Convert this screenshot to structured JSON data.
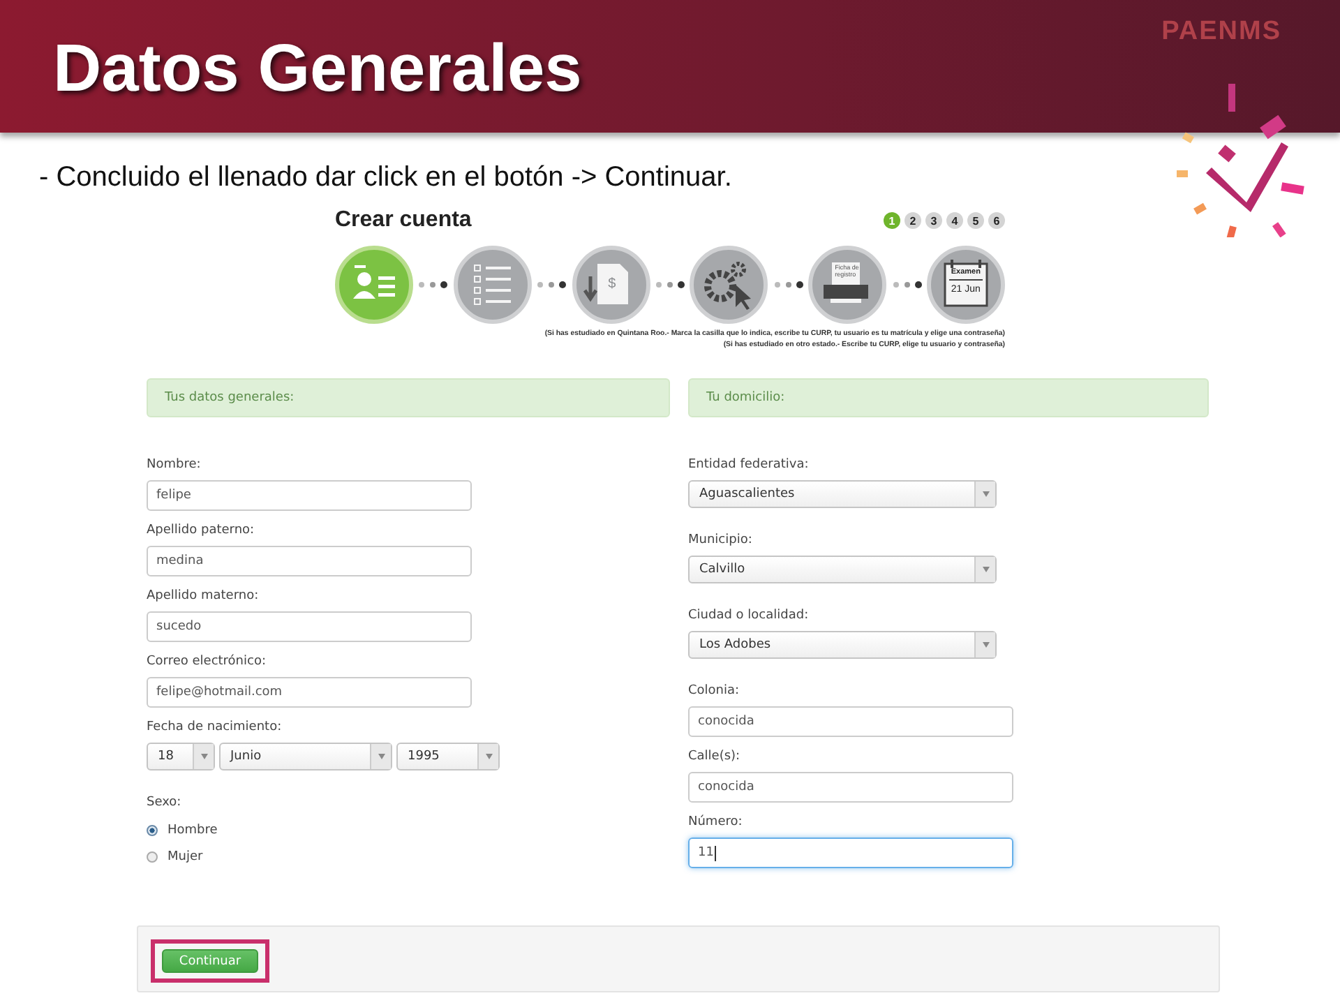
{
  "slide": {
    "title": "Datos Generales",
    "logo": "PAENMS",
    "instruction": "- Concluido el llenado dar click en el botón -> Continuar."
  },
  "wizard": {
    "title": "Crear cuenta",
    "steps": [
      {
        "number": "1",
        "selected": true
      },
      {
        "number": "2",
        "selected": false
      },
      {
        "number": "3",
        "selected": false
      },
      {
        "number": "4",
        "selected": false
      },
      {
        "number": "5",
        "selected": false
      },
      {
        "number": "6",
        "selected": false
      }
    ],
    "stages": [
      {
        "kind": "profile",
        "selected": true
      },
      {
        "kind": "checklist",
        "selected": false
      },
      {
        "kind": "payment",
        "selected": false,
        "symbol": "$"
      },
      {
        "kind": "settings",
        "selected": false
      },
      {
        "kind": "print",
        "selected": false,
        "caption": "Ficha de registro"
      },
      {
        "kind": "calendar",
        "selected": false,
        "caption": "Examen",
        "date": "21 Jun"
      }
    ],
    "notes": [
      "(Si has estudiado en Quintana Roo.- Marca la casilla que lo indica, escribe tu CURP, tu usuario es tu matrícula y elige una contraseña)",
      "(Si has estudiado en otro estado.- Escribe tu CURP, elige tu usuario y contraseña)"
    ]
  },
  "sections": [
    {
      "heading": "Tus datos generales:",
      "fields": [
        {
          "kind": "text",
          "label": "Nombre:",
          "value": "felipe",
          "focused": false
        },
        {
          "kind": "text",
          "label": "Apellido paterno:",
          "value": "medina",
          "focused": false
        },
        {
          "kind": "text",
          "label": "Apellido materno:",
          "value": "sucedo",
          "focused": false
        },
        {
          "kind": "text",
          "label": "Correo electrónico:",
          "value": "felipe@hotmail.com",
          "focused": false
        },
        {
          "kind": "date",
          "label": "Fecha de nacimiento:",
          "values": [
            "18",
            "Junio",
            "1995"
          ]
        },
        {
          "kind": "radio",
          "label": "Sexo:",
          "options": [
            {
              "label": "Hombre",
              "selected": true
            },
            {
              "label": "Mujer",
              "selected": false
            }
          ]
        }
      ]
    },
    {
      "heading": "Tu domicilio:",
      "fields": [
        {
          "kind": "select",
          "label": "Entidad federativa:",
          "value": "Aguascalientes"
        },
        {
          "kind": "select",
          "label": "Municipio:",
          "value": "Calvillo"
        },
        {
          "kind": "select",
          "label": "Ciudad o localidad:",
          "value": "Los Adobes"
        },
        {
          "kind": "text",
          "label": "Colonia:",
          "value": "conocida",
          "focused": false
        },
        {
          "kind": "text",
          "label": "Calle(s):",
          "value": "conocida",
          "focused": false
        },
        {
          "kind": "text",
          "label": "Número:",
          "value": "11",
          "focused": true
        }
      ]
    }
  ],
  "footer": {
    "button": "Continuar",
    "highlighted": true
  }
}
